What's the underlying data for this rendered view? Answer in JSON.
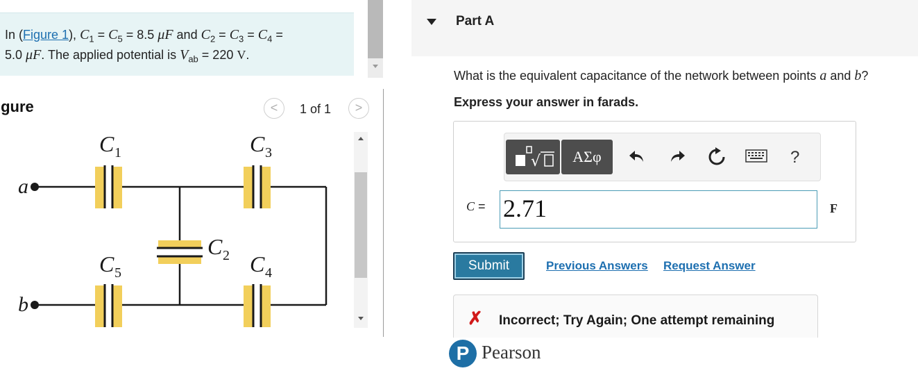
{
  "problem": {
    "text_in": "In (",
    "figure_link": "Figure 1",
    "text_close": "), ",
    "c1": "C",
    "c1_sub": "1",
    "eq1": " = ",
    "c5": "C",
    "c5_sub": "5",
    "value1": " = 8.5 ",
    "unit1": "μF",
    "and": " and ",
    "c2": "C",
    "c2_sub": "2",
    "eq2": " = ",
    "c3": "C",
    "c3_sub": "3",
    "eq3": " = ",
    "c4": "C",
    "c4_sub": "4",
    "eq4": " =",
    "value2": "5.0 ",
    "unit2": "μF",
    "potential_text": ". The applied potential is ",
    "vab": "V",
    "vab_sub": "ab",
    "value3": " = 220 ",
    "unit3": "V",
    "period": "."
  },
  "figure": {
    "title": "igure",
    "prev_symbol": "<",
    "next_symbol": ">",
    "count": "1 of 1"
  },
  "circuit": {
    "node_a": "a",
    "node_b": "b",
    "cap_c1": "C",
    "cap_c1_sub": "1",
    "cap_c2": "C",
    "cap_c2_sub": "2",
    "cap_c3": "C",
    "cap_c3_sub": "3",
    "cap_c4": "C",
    "cap_c4_sub": "4",
    "cap_c5": "C",
    "cap_c5_sub": "5",
    "plate_color": "#f2cf5b",
    "wire_color": "#1a1a1a"
  },
  "part": {
    "title": "Part A",
    "question_prefix": "What is the equivalent capacitance of the network between points ",
    "point_a": "a",
    "question_and": " and ",
    "point_b": "b",
    "question_suffix": "?",
    "instruction": "Express your answer in farads."
  },
  "toolbar": {
    "templates_icon": "templates-icon",
    "greek_label": "ΑΣφ",
    "undo_icon": "undo-icon",
    "redo_icon": "redo-icon",
    "reset_icon": "reset-icon",
    "keyboard_icon": "keyboard-icon",
    "help_label": "?"
  },
  "answer": {
    "variable": "C",
    "equals": " =",
    "value": "2.71",
    "unit": "F"
  },
  "actions": {
    "submit": "Submit",
    "previous_answers": "Previous Answers",
    "request_answer": "Request Answer"
  },
  "feedback": {
    "icon": "✗",
    "text": "Incorrect; Try Again; One attempt remaining"
  },
  "brand": {
    "logo_letter": "P",
    "name": "Pearson"
  },
  "colors": {
    "link": "#1d6fb0",
    "submit_bg": "#2a7aa0",
    "error": "#d11a1a",
    "problem_bg": "#e7f4f5"
  }
}
